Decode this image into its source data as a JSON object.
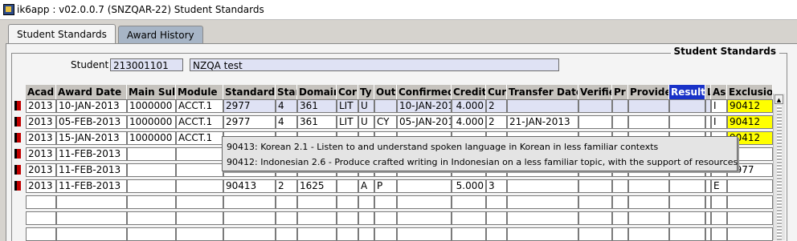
{
  "window": {
    "title": "ik6app : v02.0.0.7  (SNZQAR-22) Student Standards"
  },
  "tabs": [
    {
      "label": "Student Standards"
    },
    {
      "label": "Award History"
    }
  ],
  "section_title": "Student Standards",
  "student": {
    "label": "Student",
    "id": "213001101",
    "name": "NZQA test"
  },
  "columns": [
    "Acad",
    "Award Date",
    "Main Sul",
    "Module",
    "Standard",
    "Stan",
    "Domain",
    "Cor",
    "Ty",
    "Out",
    "Confirmed",
    "Credit",
    "Cur",
    "Transfer Date",
    "Verifie",
    "Pr",
    "Provide",
    "Result",
    "L",
    "As",
    "Exclusio"
  ],
  "rows": [
    [
      "2013",
      "10-JAN-2013",
      "1000000",
      "ACCT.1",
      "2977",
      "4",
      "361",
      "LIT",
      "U",
      "",
      "10-JAN-201",
      "4.000",
      "2",
      "",
      "",
      "",
      "",
      "",
      "",
      "I",
      "90412"
    ],
    [
      "2013",
      "05-FEB-2013",
      "1000000",
      "ACCT.1",
      "2977",
      "4",
      "361",
      "LIT",
      "U",
      "CY",
      "05-JAN-201",
      "4.000",
      "2",
      "21-JAN-2013",
      "",
      "",
      "",
      "",
      "",
      "I",
      "90412"
    ],
    [
      "2013",
      "15-JAN-2013",
      "1000000",
      "ACCT.1",
      "",
      "",
      "",
      "",
      "",
      "",
      "",
      "",
      "",
      "",
      "",
      "",
      "",
      "",
      "",
      "",
      "90412"
    ],
    [
      "2013",
      "11-FEB-2013",
      "",
      "",
      "",
      "",
      "",
      "",
      "",
      "",
      "",
      "",
      "",
      "",
      "",
      "",
      "",
      "",
      "",
      "",
      ""
    ],
    [
      "2013",
      "11-FEB-2013",
      "",
      "",
      "1211",
      "",
      "1",
      "",
      "",
      "",
      "",
      "",
      "",
      "",
      "",
      "",
      "",
      "",
      "",
      "",
      "2977"
    ],
    [
      "2013",
      "11-FEB-2013",
      "",
      "",
      "90413",
      "2",
      "1625",
      "",
      "A",
      "P",
      "",
      "5.000",
      "3",
      "",
      "",
      "",
      "",
      "",
      "",
      "E",
      ""
    ]
  ],
  "tooltip": {
    "lines": [
      "90413: Korean 2.1 - Listen to and understand spoken language in Korean in less familiar contexts",
      "90412: Indonesian 2.6 - Produce crafted writing in Indonesian on a less familiar topic, with the support of resources"
    ]
  },
  "colors": {
    "field_bg": "#dfe2f4",
    "exclusion_highlight": "#ffff00",
    "selected_header": "#1932c8",
    "row_marker": "#c00000"
  }
}
